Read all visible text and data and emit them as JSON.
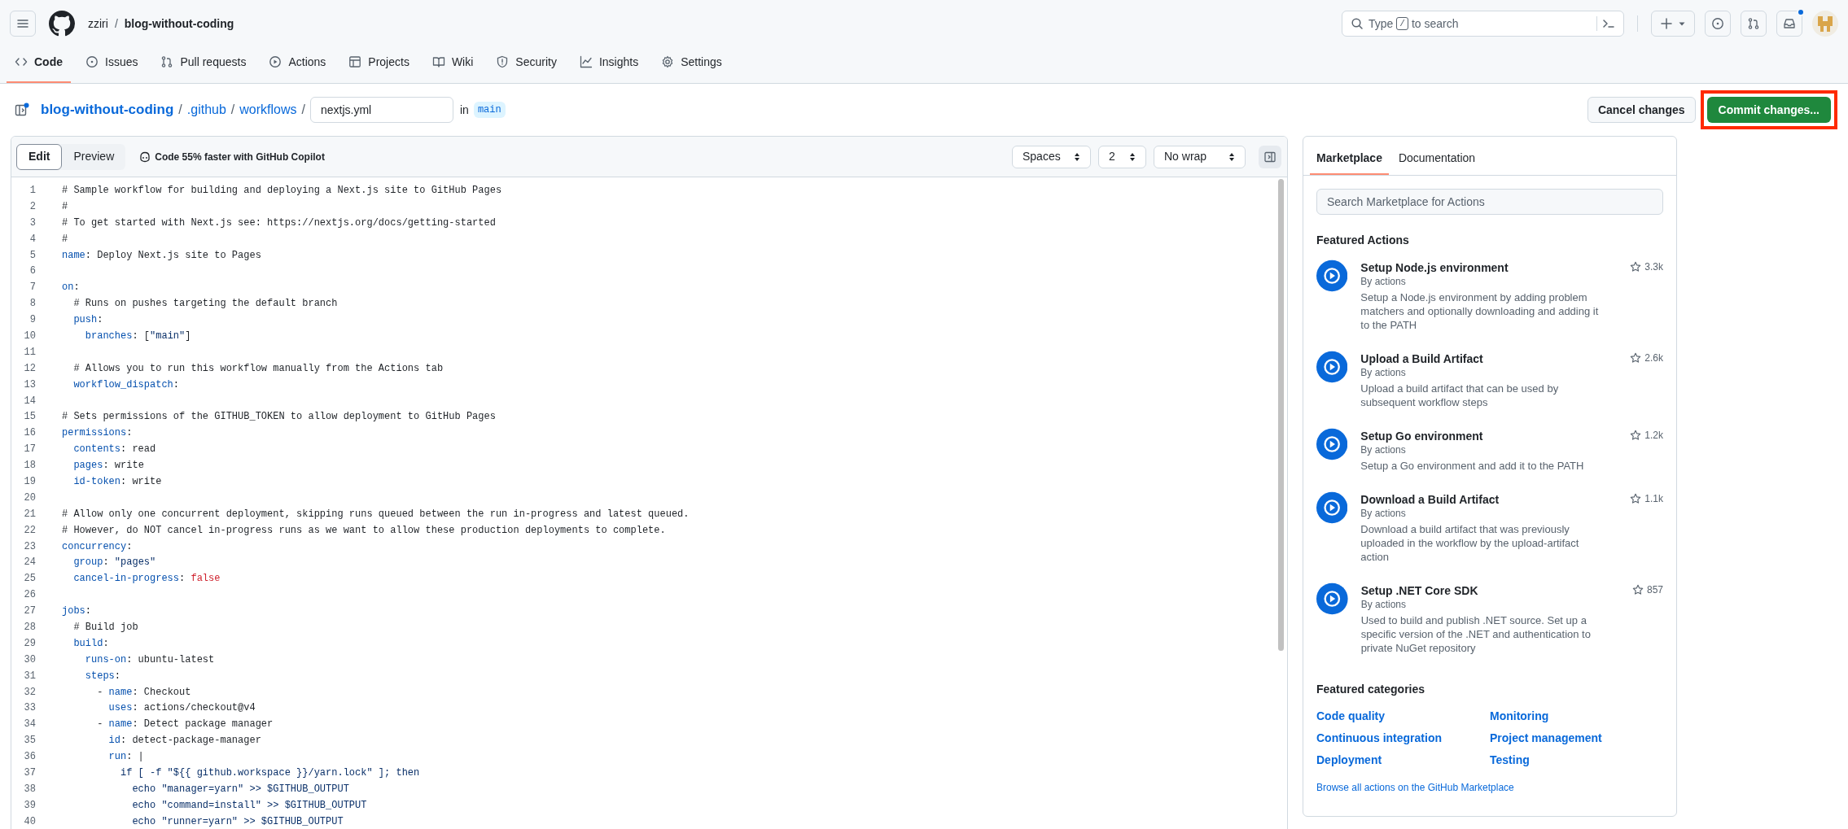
{
  "header": {
    "owner": "zziri",
    "separator": "/",
    "repo": "blog-without-coding",
    "search": {
      "before": "Type",
      "key": "/",
      "after": "to search"
    },
    "inbox_unread": true
  },
  "repo_tabs": [
    {
      "label": "Code",
      "kind": "code",
      "selected": true
    },
    {
      "label": "Issues",
      "kind": "issue",
      "selected": false
    },
    {
      "label": "Pull requests",
      "kind": "pr",
      "selected": false
    },
    {
      "label": "Actions",
      "kind": "play",
      "selected": false
    },
    {
      "label": "Projects",
      "kind": "table",
      "selected": false
    },
    {
      "label": "Wiki",
      "kind": "book",
      "selected": false
    },
    {
      "label": "Security",
      "kind": "shield",
      "selected": false
    },
    {
      "label": "Insights",
      "kind": "graph",
      "selected": false
    },
    {
      "label": "Settings",
      "kind": "gear",
      "selected": false
    }
  ],
  "breadcrumb": {
    "repo": "blog-without-coding",
    "folders": [
      ".github",
      "workflows"
    ],
    "separator": "/",
    "filename": "nextjs.yml",
    "in_label": "in",
    "branch": "main"
  },
  "actions": {
    "cancel": "Cancel changes",
    "commit": "Commit changes...",
    "commit_highlighted": true
  },
  "editor": {
    "tabs": [
      {
        "label": "Edit",
        "selected": true
      },
      {
        "label": "Preview",
        "selected": false
      }
    ],
    "copilot": "Code 55% faster with GitHub Copilot",
    "selects": [
      "Spaces",
      "2",
      "No wrap"
    ],
    "lines": [
      {
        "number": "1",
        "segments": [
          {
            "kind": "comment",
            "text": "# Sample workflow for building and deploying a Next.js site to GitHub Pages"
          }
        ]
      },
      {
        "number": "2",
        "segments": [
          {
            "kind": "comment",
            "text": "#"
          }
        ]
      },
      {
        "number": "3",
        "segments": [
          {
            "kind": "comment",
            "text": "# To get started with Next.js see: https://nextjs.org/docs/getting-started"
          }
        ]
      },
      {
        "number": "4",
        "segments": [
          {
            "kind": "comment",
            "text": "#"
          }
        ]
      },
      {
        "number": "5",
        "segments": [
          {
            "kind": "key",
            "text": "name"
          },
          {
            "kind": "plain",
            "text": ": Deploy Next.js site to Pages"
          }
        ]
      },
      {
        "number": "6"
      },
      {
        "number": "7",
        "segments": [
          {
            "kind": "key",
            "text": "on"
          },
          {
            "kind": "plain",
            "text": ":"
          }
        ]
      },
      {
        "number": "8",
        "segments": [
          {
            "kind": "comment",
            "text": "  # Runs on pushes targeting the default branch"
          }
        ]
      },
      {
        "number": "9",
        "segments": [
          {
            "kind": "key",
            "text": "  push"
          },
          {
            "kind": "plain",
            "text": ":"
          }
        ]
      },
      {
        "number": "10",
        "segments": [
          {
            "kind": "key",
            "text": "    branches"
          },
          {
            "kind": "plain",
            "text": ": ["
          },
          {
            "kind": "string",
            "text": "\"main\""
          },
          {
            "kind": "plain",
            "text": "]"
          }
        ]
      },
      {
        "number": "11"
      },
      {
        "number": "12",
        "segments": [
          {
            "kind": "comment",
            "text": "  # Allows you to run this workflow manually from the Actions tab"
          }
        ]
      },
      {
        "number": "13",
        "segments": [
          {
            "kind": "key",
            "text": "  workflow_dispatch"
          },
          {
            "kind": "plain",
            "text": ":"
          }
        ]
      },
      {
        "number": "14"
      },
      {
        "number": "15",
        "segments": [
          {
            "kind": "comment",
            "text": "# Sets permissions of the GITHUB_TOKEN to allow deployment to GitHub Pages"
          }
        ]
      },
      {
        "number": "16",
        "segments": [
          {
            "kind": "key",
            "text": "permissions"
          },
          {
            "kind": "plain",
            "text": ":"
          }
        ]
      },
      {
        "number": "17",
        "segments": [
          {
            "kind": "key",
            "text": "  contents"
          },
          {
            "kind": "plain",
            "text": ": read"
          }
        ]
      },
      {
        "number": "18",
        "segments": [
          {
            "kind": "key",
            "text": "  pages"
          },
          {
            "kind": "plain",
            "text": ": write"
          }
        ]
      },
      {
        "number": "19",
        "segments": [
          {
            "kind": "key",
            "text": "  id-token"
          },
          {
            "kind": "plain",
            "text": ": write"
          }
        ]
      },
      {
        "number": "20"
      },
      {
        "number": "21",
        "segments": [
          {
            "kind": "comment",
            "text": "# Allow only one concurrent deployment, skipping runs queued between the run in-progress and latest queued."
          }
        ]
      },
      {
        "number": "22",
        "segments": [
          {
            "kind": "comment",
            "text": "# However, do NOT cancel in-progress runs as we want to allow these production deployments to complete."
          }
        ]
      },
      {
        "number": "23",
        "segments": [
          {
            "kind": "key",
            "text": "concurrency"
          },
          {
            "kind": "plain",
            "text": ":"
          }
        ]
      },
      {
        "number": "24",
        "segments": [
          {
            "kind": "key",
            "text": "  group"
          },
          {
            "kind": "plain",
            "text": ": "
          },
          {
            "kind": "string",
            "text": "\"pages\""
          }
        ]
      },
      {
        "number": "25",
        "segments": [
          {
            "kind": "key",
            "text": "  cancel-in-progress"
          },
          {
            "kind": "plain",
            "text": ": "
          },
          {
            "kind": "bool",
            "text": "false"
          }
        ]
      },
      {
        "number": "26"
      },
      {
        "number": "27",
        "segments": [
          {
            "kind": "key",
            "text": "jobs"
          },
          {
            "kind": "plain",
            "text": ":"
          }
        ]
      },
      {
        "number": "28",
        "segments": [
          {
            "kind": "comment",
            "text": "  # Build job"
          }
        ]
      },
      {
        "number": "29",
        "segments": [
          {
            "kind": "key",
            "text": "  build"
          },
          {
            "kind": "plain",
            "text": ":"
          }
        ]
      },
      {
        "number": "30",
        "segments": [
          {
            "kind": "key",
            "text": "    runs-on"
          },
          {
            "kind": "plain",
            "text": ": ubuntu-latest"
          }
        ]
      },
      {
        "number": "31",
        "segments": [
          {
            "kind": "key",
            "text": "    steps"
          },
          {
            "kind": "plain",
            "text": ":"
          }
        ]
      },
      {
        "number": "32",
        "segments": [
          {
            "kind": "plain",
            "text": "      - "
          },
          {
            "kind": "key",
            "text": "name"
          },
          {
            "kind": "plain",
            "text": ": Checkout"
          }
        ]
      },
      {
        "number": "33",
        "segments": [
          {
            "kind": "key",
            "text": "        uses"
          },
          {
            "kind": "plain",
            "text": ": actions/checkout@v4"
          }
        ]
      },
      {
        "number": "34",
        "segments": [
          {
            "kind": "plain",
            "text": "      - "
          },
          {
            "kind": "key",
            "text": "name"
          },
          {
            "kind": "plain",
            "text": ": Detect package manager"
          }
        ]
      },
      {
        "number": "35",
        "segments": [
          {
            "kind": "key",
            "text": "        id"
          },
          {
            "kind": "plain",
            "text": ": detect-package-manager"
          }
        ]
      },
      {
        "number": "36",
        "segments": [
          {
            "kind": "key",
            "text": "        run"
          },
          {
            "kind": "plain",
            "text": ": |"
          }
        ]
      },
      {
        "number": "37",
        "segments": [
          {
            "kind": "string",
            "text": "          if [ -f \"${{ github.workspace }}/yarn.lock\" ]; then"
          }
        ]
      },
      {
        "number": "38",
        "segments": [
          {
            "kind": "string",
            "text": "            echo \"manager=yarn\" >> $GITHUB_OUTPUT"
          }
        ]
      },
      {
        "number": "39",
        "segments": [
          {
            "kind": "string",
            "text": "            echo \"command=install\" >> $GITHUB_OUTPUT"
          }
        ]
      },
      {
        "number": "40",
        "segments": [
          {
            "kind": "string",
            "text": "            echo \"runner=yarn\" >> $GITHUB_OUTPUT"
          }
        ]
      }
    ]
  },
  "marketplace": {
    "tabs": [
      {
        "label": "Marketplace",
        "selected": true
      },
      {
        "label": "Documentation",
        "selected": false
      }
    ],
    "search": {
      "placeholder": "Search Marketplace for Actions"
    },
    "featured_heading": "Featured Actions",
    "actions": [
      {
        "title": "Setup Node.js environment",
        "author": "By actions",
        "description": "Setup a Node.js environment by adding problem matchers and optionally downloading and adding it to the PATH",
        "stars": "3.3k"
      },
      {
        "title": "Upload a Build Artifact",
        "author": "By actions",
        "description": "Upload a build artifact that can be used by subsequent workflow steps",
        "stars": "2.6k"
      },
      {
        "title": "Setup Go environment",
        "author": "By actions",
        "description": "Setup a Go environment and add it to the PATH",
        "stars": "1.2k"
      },
      {
        "title": "Download a Build Artifact",
        "author": "By actions",
        "description": "Download a build artifact that was previously uploaded in the workflow by the upload-artifact action",
        "stars": "1.1k"
      },
      {
        "title": "Setup .NET Core SDK",
        "author": "By actions",
        "description": "Used to build and publish .NET source. Set up a specific version of the .NET and authentication to private NuGet repository",
        "stars": "857"
      }
    ],
    "categories_heading": "Featured categories",
    "categories": [
      "Code quality",
      "Monitoring",
      "Continuous integration",
      "Project management",
      "Deployment",
      "Testing"
    ],
    "browse_link": "Browse all actions on the GitHub Marketplace"
  }
}
